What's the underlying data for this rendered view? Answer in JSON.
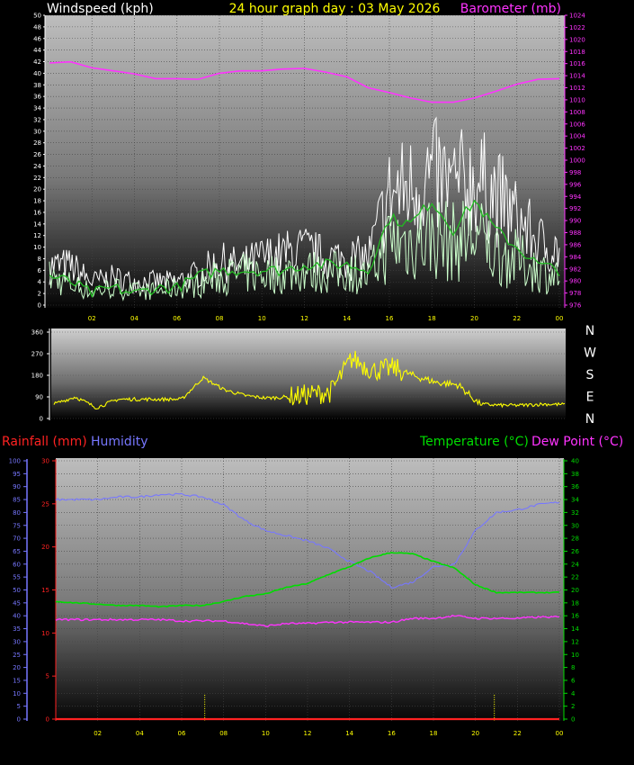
{
  "header": {
    "windspeed_label": "Windspeed (kph)",
    "graph_title": "24 hour graph day : 03 May 2026",
    "barometer_label": "Barometer (mb)"
  },
  "compass": [
    "N",
    "W",
    "S",
    "E",
    "N"
  ],
  "lower_header": {
    "rainfall_label": "Rainfall (mm)",
    "humidity_label": "Humidity",
    "temperature_label": "Temperature (°C)",
    "dewpoint_label": "Dew Point (°C)"
  },
  "colors": {
    "wind_gust": "#ffffff",
    "wind_avg": "#ccffcc",
    "wind_trend": "#22bb22",
    "barometer": "#ff33ff",
    "direction": "#ffff00",
    "rain": "#ff2222",
    "humidity": "#7777ff",
    "temperature": "#00dd00",
    "dewpoint": "#ff33ff",
    "hour_tick": "#ffff00"
  },
  "chart_data": [
    {
      "type": "line",
      "name": "wind-barometer",
      "x_ticks": [
        "02",
        "04",
        "06",
        "08",
        "10",
        "12",
        "14",
        "16",
        "18",
        "20",
        "22",
        "00"
      ],
      "y_left_ticks": [
        "0",
        "2",
        "4",
        "6",
        "8",
        "10",
        "12",
        "14",
        "16",
        "18",
        "20",
        "22",
        "24",
        "26",
        "28",
        "30",
        "32",
        "34",
        "36",
        "38",
        "40",
        "42",
        "44",
        "46",
        "48",
        "50"
      ],
      "y_right_ticks": [
        "976",
        "978",
        "980",
        "982",
        "984",
        "986",
        "988",
        "990",
        "992",
        "994",
        "996",
        "998",
        "1000",
        "1002",
        "1004",
        "1006",
        "1008",
        "1010",
        "1012",
        "1014",
        "1016",
        "1018",
        "1020",
        "1022",
        "1024"
      ],
      "ylim_left": [
        0,
        50
      ],
      "ylim_right": [
        976,
        1024
      ],
      "x_hours": [
        0,
        1,
        2,
        3,
        4,
        5,
        6,
        7,
        8,
        9,
        10,
        11,
        12,
        13,
        14,
        15,
        16,
        17,
        18,
        19,
        20,
        21,
        22,
        23,
        24
      ],
      "barometer_mb": [
        1016.1,
        1016.3,
        1015.3,
        1014.8,
        1014.3,
        1013.5,
        1013.5,
        1013.4,
        1014.4,
        1014.8,
        1014.8,
        1015.1,
        1015.2,
        1014.6,
        1013.8,
        1012.0,
        1011.2,
        1010.3,
        1009.6,
        1009.6,
        1010.3,
        1011.4,
        1012.6,
        1013.4,
        1013.5
      ],
      "wind_gust_peak": [
        10,
        10,
        6,
        7,
        6,
        6,
        6,
        8,
        11,
        10,
        12,
        13,
        14,
        12,
        12,
        12,
        28,
        30,
        33,
        30,
        32,
        28,
        22,
        16,
        14
      ],
      "wind_avg_peak": [
        8,
        6,
        4,
        5,
        4,
        4,
        5,
        6,
        8,
        9,
        9,
        9,
        10,
        9,
        10,
        8,
        18,
        18,
        20,
        18,
        20,
        15,
        13,
        10,
        8
      ],
      "wind_trend": [
        5,
        4,
        2,
        3,
        2,
        3,
        3,
        5,
        6,
        6,
        6,
        6,
        7,
        7,
        7,
        6,
        15,
        14,
        18,
        13,
        18,
        13,
        10,
        7,
        6
      ]
    },
    {
      "type": "line",
      "name": "wind-direction",
      "x_hours": [
        0,
        1,
        2,
        3,
        4,
        5,
        6,
        7,
        8,
        9,
        10,
        11,
        12,
        13,
        14,
        15,
        16,
        17,
        18,
        19,
        20,
        21,
        22,
        23,
        24
      ],
      "direction_deg": [
        60,
        90,
        45,
        80,
        80,
        80,
        80,
        170,
        120,
        95,
        85,
        90,
        100,
        110,
        250,
        200,
        210,
        175,
        150,
        140,
        60,
        55,
        55,
        60,
        58
      ],
      "y_ticks": [
        "0",
        "90",
        "180",
        "270",
        "360"
      ],
      "ylim": [
        0,
        360
      ]
    },
    {
      "type": "line",
      "name": "temp-humidity",
      "x_ticks": [
        "02",
        "04",
        "06",
        "08",
        "10",
        "12",
        "14",
        "16",
        "18",
        "20",
        "22",
        "00"
      ],
      "y_left_outer_ticks": [
        "0",
        "5",
        "10",
        "15",
        "20",
        "25",
        "30",
        "35",
        "40",
        "45",
        "50",
        "55",
        "60",
        "65",
        "70",
        "75",
        "80",
        "85",
        "90",
        "95",
        "100"
      ],
      "y_left_inner_ticks": [
        "0",
        "5",
        "10",
        "15",
        "20",
        "25",
        "30"
      ],
      "y_right_ticks": [
        "0",
        "2",
        "4",
        "6",
        "8",
        "10",
        "12",
        "14",
        "16",
        "18",
        "20",
        "22",
        "24",
        "26",
        "28",
        "30",
        "32",
        "34",
        "36",
        "38",
        "40"
      ],
      "ylim_humidity": [
        0,
        100
      ],
      "ylim_rain": [
        0,
        30
      ],
      "ylim_temp": [
        0,
        40
      ],
      "x_hours": [
        0,
        1,
        2,
        3,
        4,
        5,
        6,
        7,
        8,
        9,
        10,
        11,
        12,
        13,
        14,
        15,
        16,
        17,
        18,
        19,
        20,
        21,
        22,
        23,
        24
      ],
      "humidity_pct": [
        85,
        85,
        85,
        86,
        86,
        87,
        87,
        86,
        83,
        77,
        73,
        71,
        69,
        66,
        61,
        57,
        51,
        53,
        59,
        60,
        73,
        80,
        81,
        83,
        84
      ],
      "temperature_c": [
        18.2,
        18.0,
        17.8,
        17.6,
        17.6,
        17.4,
        17.6,
        17.6,
        18.2,
        19.0,
        19.4,
        20.4,
        21.0,
        22.4,
        23.6,
        25.0,
        25.8,
        25.6,
        24.4,
        23.4,
        20.8,
        19.6,
        19.6,
        19.6,
        19.6
      ],
      "dewpoint_c": [
        15.4,
        15.4,
        15.4,
        15.4,
        15.4,
        15.4,
        15.2,
        15.2,
        15.2,
        14.8,
        14.4,
        14.8,
        14.8,
        15.0,
        15.0,
        15.0,
        15.0,
        15.6,
        15.6,
        16.0,
        15.6,
        15.6,
        15.6,
        15.8,
        15.8
      ],
      "rainfall_mm": [
        0,
        0,
        0,
        0,
        0,
        0,
        0,
        0,
        0,
        0,
        0,
        0,
        0,
        0,
        0,
        0,
        0,
        0,
        0,
        0,
        0,
        0,
        0,
        0,
        0
      ]
    }
  ]
}
